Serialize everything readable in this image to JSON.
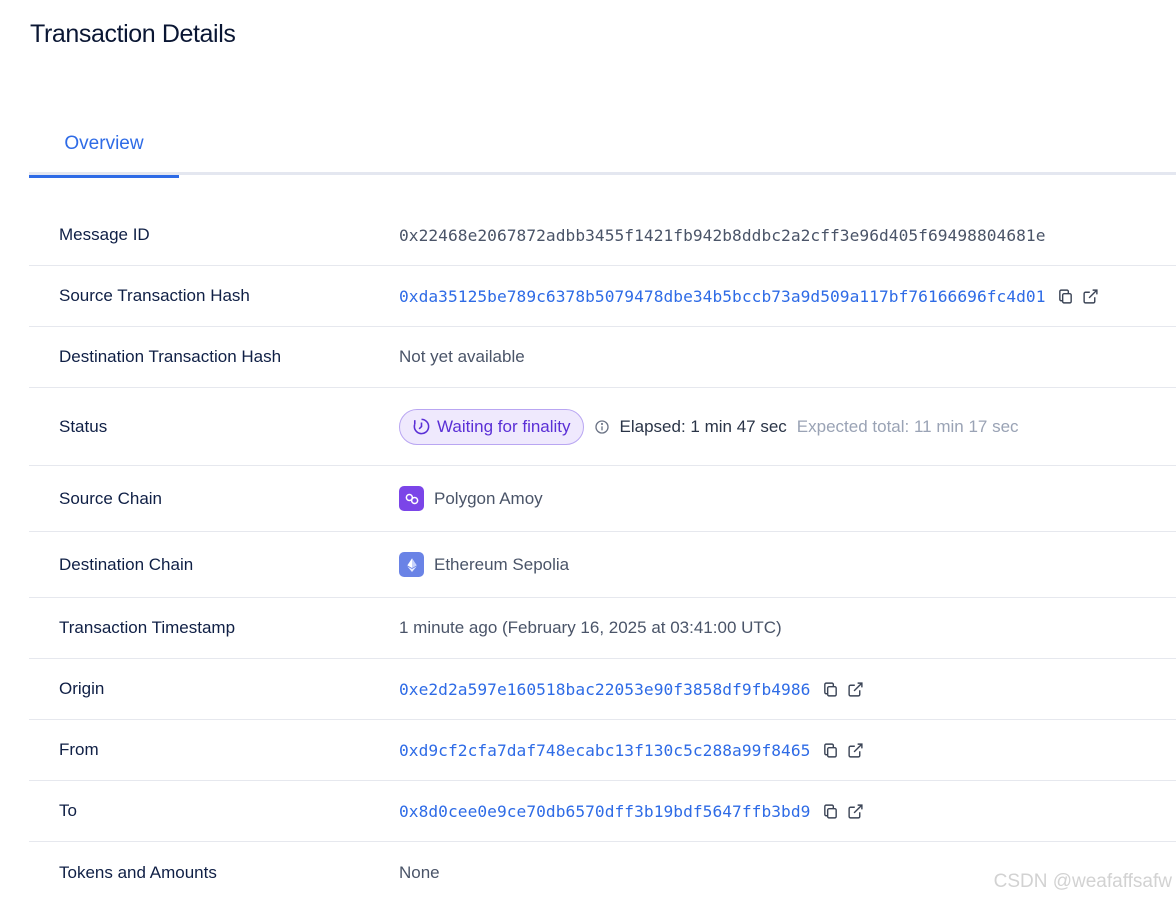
{
  "page": {
    "title": "Transaction Details"
  },
  "tabs": [
    {
      "label": "Overview",
      "active": true
    }
  ],
  "rows": {
    "message_id": {
      "label": "Message ID",
      "value": "0x22468e2067872adbb3455f1421fb942b8ddbc2a2cff3e96d405f69498804681e"
    },
    "source_tx_hash": {
      "label": "Source Transaction Hash",
      "value": "0xda35125be789c6378b5079478dbe34b5bccb73a9d509a117bf76166696fc4d01"
    },
    "dest_tx_hash": {
      "label": "Destination Transaction Hash",
      "value": "Not yet available"
    },
    "status": {
      "label": "Status",
      "badge": "Waiting for finality",
      "elapsed": "Elapsed: 1 min 47 sec",
      "expected": "Expected total: 11 min 17 sec"
    },
    "source_chain": {
      "label": "Source Chain",
      "value": "Polygon Amoy",
      "icon": "polygon-icon"
    },
    "dest_chain": {
      "label": "Destination Chain",
      "value": "Ethereum Sepolia",
      "icon": "ethereum-icon"
    },
    "timestamp": {
      "label": "Transaction Timestamp",
      "value": "1 minute ago (February 16, 2025 at 03:41:00 UTC)"
    },
    "origin": {
      "label": "Origin",
      "value": "0xe2d2a597e160518bac22053e90f3858df9fb4986"
    },
    "from": {
      "label": "From",
      "value": "0xd9cf2cfa7daf748ecabc13f130c5c288a99f8465"
    },
    "to": {
      "label": "To",
      "value": "0x8d0cee0e9ce70db6570dff3b19bdf5647ffb3bd9"
    },
    "tokens": {
      "label": "Tokens and Amounts",
      "value": "None"
    }
  },
  "watermark": "CSDN @weafaffsafw",
  "colors": {
    "link": "#2e6be6",
    "badge_bg": "#efe9fd",
    "badge_text": "#5a2fd6",
    "polygon": "#7b45e8",
    "ethereum": "#6a83e6"
  }
}
